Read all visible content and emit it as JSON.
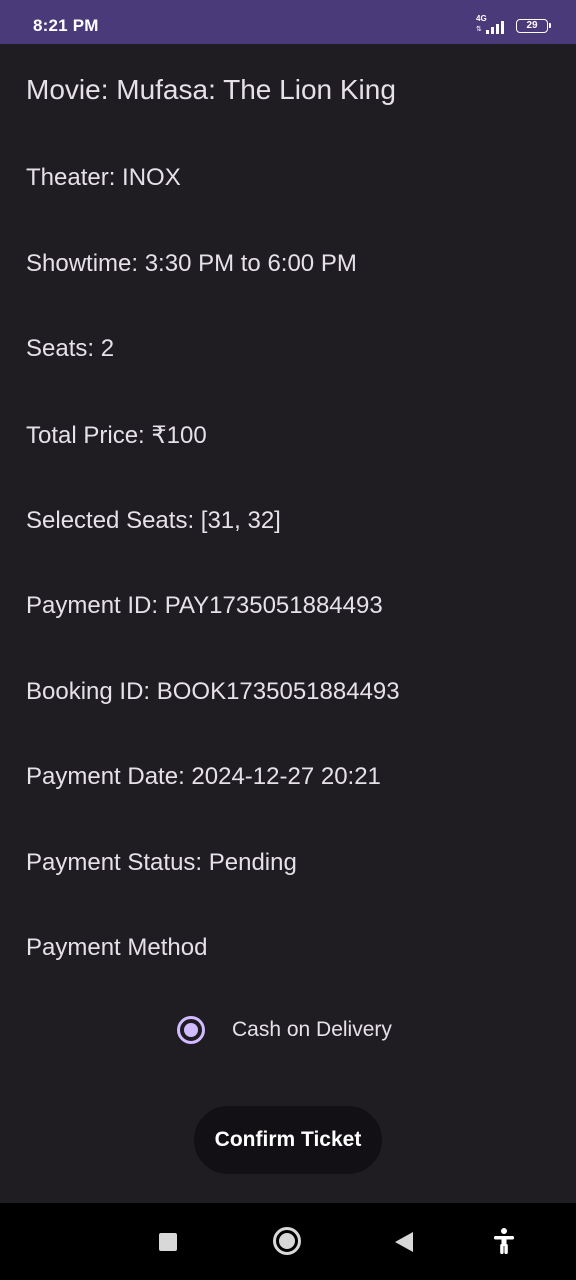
{
  "status_bar": {
    "time": "8:21 PM",
    "network": "4G",
    "battery": "29",
    "color": "#4a3a7a"
  },
  "booking": {
    "movie": "Movie: Mufasa: The Lion King",
    "theater": "Theater: INOX",
    "showtime": "Showtime: 3:30 PM to 6:00 PM",
    "seats": "Seats: 2",
    "total_price": "Total Price: ₹100",
    "selected_seats": "Selected Seats: [31, 32]",
    "payment_id": "Payment ID: PAY1735051884493",
    "booking_id": "Booking ID: BOOK1735051884493",
    "payment_date": "Payment Date: 2024-12-27 20:21",
    "payment_status": "Payment Status: Pending",
    "payment_method_label": "Payment Method"
  },
  "payment_options": [
    {
      "label": "Cash on Delivery",
      "selected": true
    }
  ],
  "confirm_button": {
    "label": "Confirm Ticket"
  },
  "nav_bar": {
    "icons": [
      "recents-icon",
      "home-icon",
      "back-icon",
      "accessibility-icon"
    ]
  },
  "colors": {
    "background": "#1f1c22",
    "text": "#e6e0e9",
    "accent": "#d0bcff",
    "button_bg": "#121014"
  }
}
